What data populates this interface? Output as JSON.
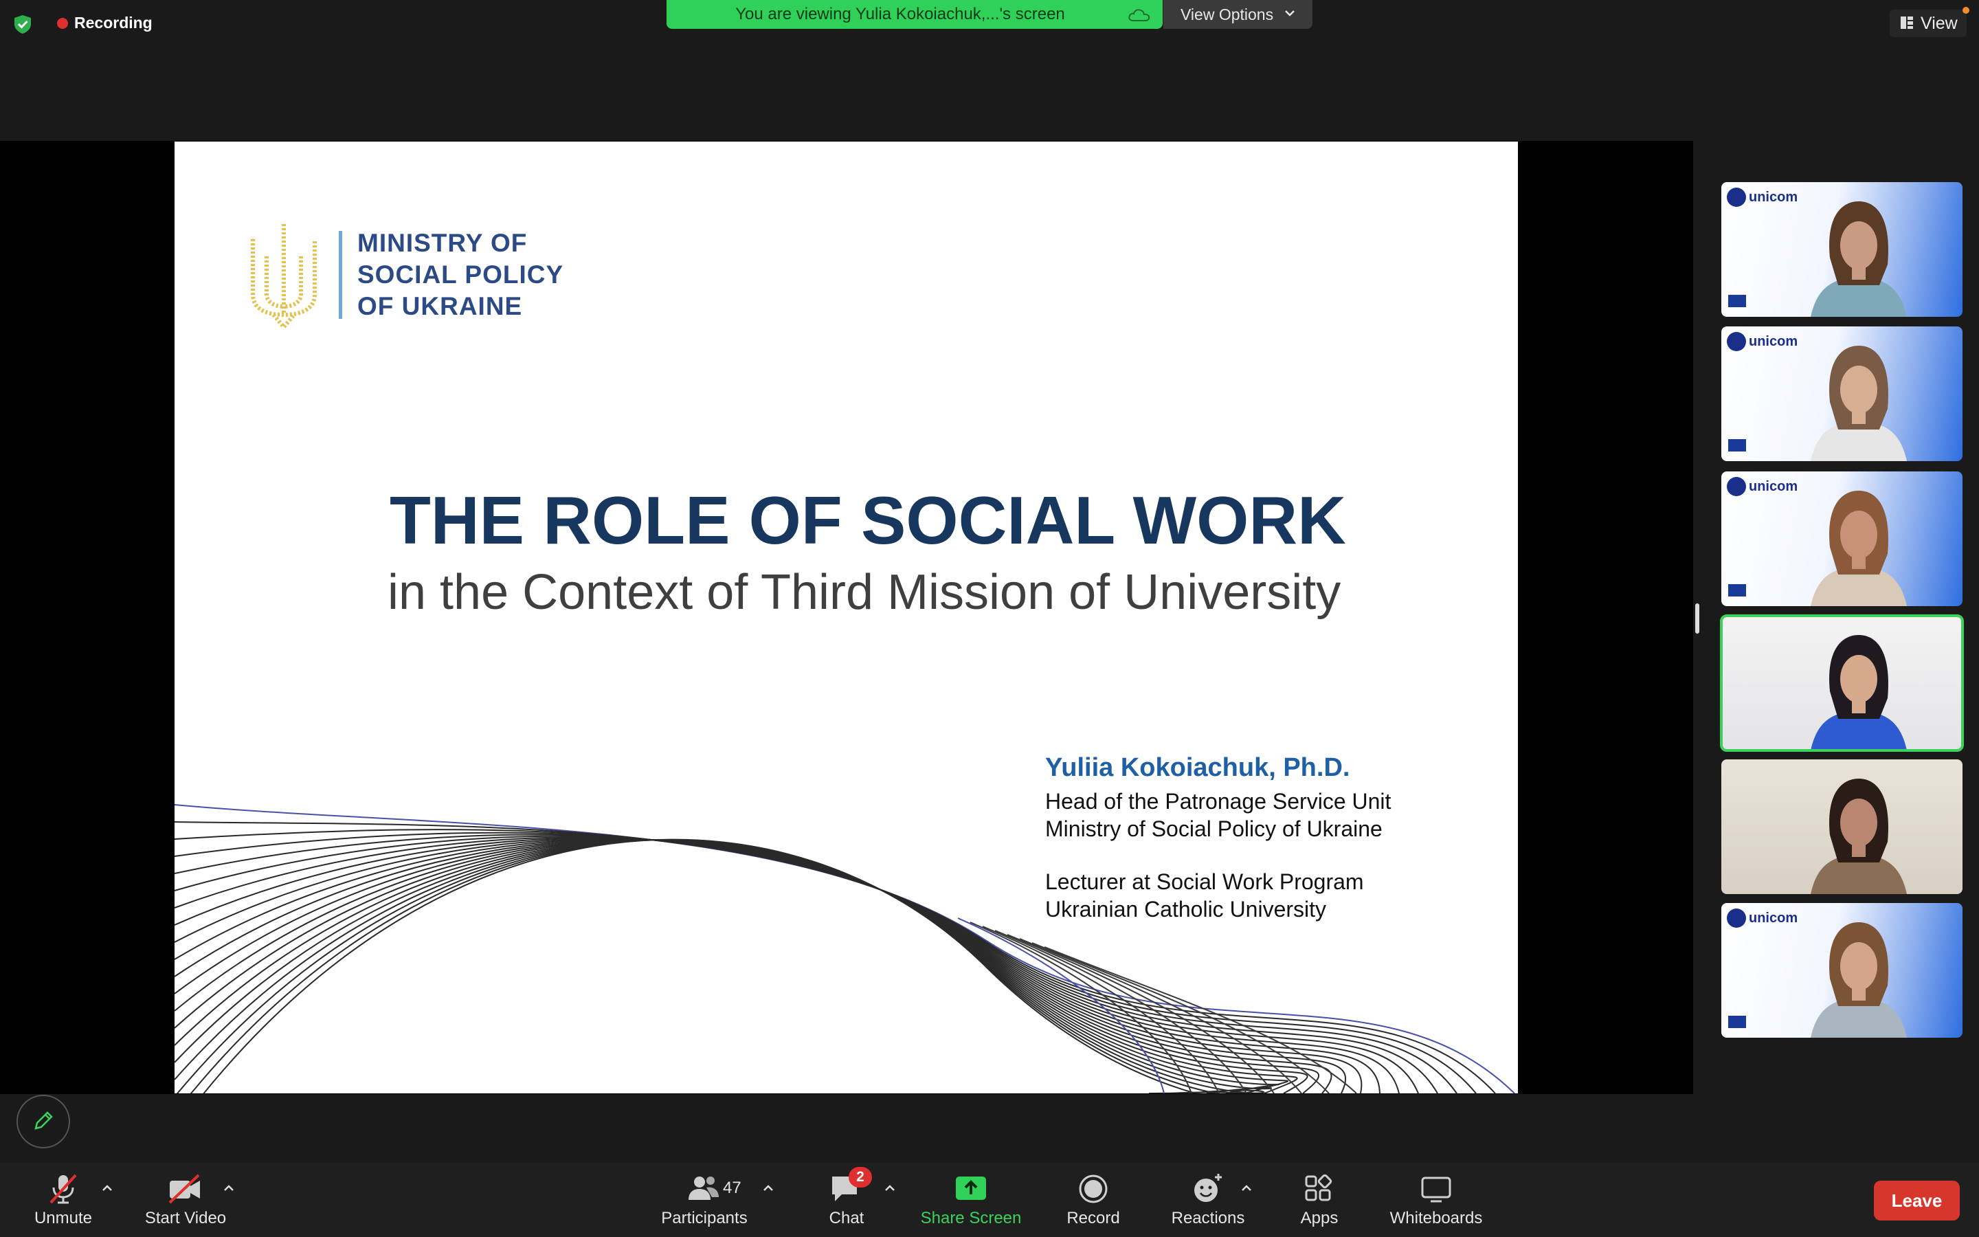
{
  "top_bar": {
    "recording_label": "Recording",
    "banner_text": "You are viewing Yulia Kokoiachuk,...'s screen",
    "view_options_label": "View Options",
    "view_label": "View"
  },
  "slide": {
    "ministry_lines": [
      "MINISTRY OF",
      "SOCIAL POLICY",
      "OF UKRAINE"
    ],
    "title": "THE ROLE OF SOCIAL WORK",
    "subtitle": "in the Context of Third Mission of University",
    "author": "Yuliia Kokoiachuk, Ph.D.",
    "author_lines": [
      "Head of the Patronage Service Unit",
      "Ministry of Social Policy of Ukraine",
      "Lecturer at Social Work Program",
      "Ukrainian Catholic University"
    ]
  },
  "gallery": {
    "brand_label": "unicom",
    "tiles": [
      {
        "has_brand": true,
        "active": false
      },
      {
        "has_brand": true,
        "active": false
      },
      {
        "has_brand": true,
        "active": false
      },
      {
        "has_brand": false,
        "active": true
      },
      {
        "has_brand": false,
        "active": false
      },
      {
        "has_brand": true,
        "active": false
      }
    ]
  },
  "toolbar": {
    "unmute_label": "Unmute",
    "start_video_label": "Start Video",
    "participants_count": "47",
    "participants_label": "Participants",
    "chat_label": "Chat",
    "chat_badge": "2",
    "share_screen_label": "Share Screen",
    "record_label": "Record",
    "reactions_label": "Reactions",
    "apps_label": "Apps",
    "whiteboards_label": "Whiteboards",
    "leave_label": "Leave"
  },
  "colors": {
    "banner_green": "#2fd158",
    "leave_red": "#d6362b",
    "slide_title_navy": "#17375e",
    "author_blue": "#1f5fa5",
    "active_outline": "#3bd15a"
  }
}
